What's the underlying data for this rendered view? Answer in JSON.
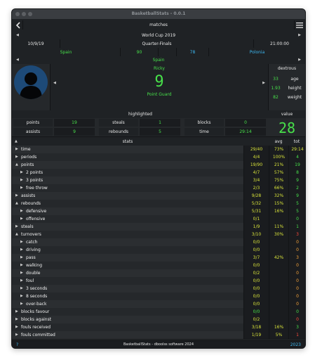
{
  "window": {
    "title": "BasketballStats - 0.0.1"
  },
  "nav": {
    "title": "matches"
  },
  "match": {
    "competition": "World Cup 2019",
    "date": "10/9/19",
    "phase": "Quarter-Finals",
    "clock": "21:00:00",
    "team_home": "Spain",
    "score_home": "90",
    "score_away": "78",
    "team_away": "Polonia"
  },
  "team_selected": "Spain",
  "player": {
    "name": "Ricky",
    "number": "9",
    "position": "Point Guard",
    "hand": "dextrous",
    "age_value": "33",
    "age_label": "age",
    "height_value": "1.93",
    "height_label": "height",
    "weight_value": "82",
    "weight_label": "weight"
  },
  "highlighted": {
    "header": "highlighted",
    "value_header": "value",
    "value": "28",
    "rows": [
      [
        {
          "label": "points",
          "value": "19"
        },
        {
          "label": "steals",
          "value": "1"
        },
        {
          "label": "blocks",
          "value": "0"
        }
      ],
      [
        {
          "label": "assists",
          "value": "9"
        },
        {
          "label": "rebounds",
          "value": "5"
        },
        {
          "label": "time",
          "value": "29:14"
        }
      ]
    ]
  },
  "stats_header": {
    "label": "stats",
    "avg": "avg",
    "tot": "tot"
  },
  "stats": [
    {
      "label": "time",
      "level": 0,
      "open": false,
      "v1": "29/40",
      "v1c": "y",
      "v2": "73%",
      "v2c": "y",
      "v3": "29:14",
      "v3c": "y"
    },
    {
      "label": "periods",
      "level": 0,
      "open": false,
      "v1": "4/4",
      "v1c": "y",
      "v2": "100%",
      "v2c": "y",
      "v3": "4",
      "v3c": "g"
    },
    {
      "label": "points",
      "level": 0,
      "open": true,
      "v1": "19/90",
      "v1c": "y",
      "v2": "21%",
      "v2c": "y",
      "v3": "19",
      "v3c": "g"
    },
    {
      "label": "2 points",
      "level": 1,
      "open": false,
      "v1": "4/7",
      "v1c": "y",
      "v2": "57%",
      "v2c": "y",
      "v3": "8",
      "v3c": "g"
    },
    {
      "label": "3 points",
      "level": 1,
      "open": false,
      "v1": "3/4",
      "v1c": "y",
      "v2": "75%",
      "v2c": "y",
      "v3": "9",
      "v3c": "g"
    },
    {
      "label": "free throw",
      "level": 1,
      "open": false,
      "v1": "2/3",
      "v1c": "y",
      "v2": "66%",
      "v2c": "y",
      "v3": "2",
      "v3c": "g"
    },
    {
      "label": "assists",
      "level": 0,
      "open": false,
      "v1": "9/28",
      "v1c": "y",
      "v2": "32%",
      "v2c": "y",
      "v3": "9",
      "v3c": "g"
    },
    {
      "label": "rebounds",
      "level": 0,
      "open": true,
      "v1": "5/32",
      "v1c": "y",
      "v2": "15%",
      "v2c": "y",
      "v3": "5",
      "v3c": "g"
    },
    {
      "label": "defensive",
      "level": 1,
      "open": false,
      "v1": "5/31",
      "v1c": "y",
      "v2": "16%",
      "v2c": "y",
      "v3": "5",
      "v3c": "g"
    },
    {
      "label": "offensive",
      "level": 1,
      "open": false,
      "v1": "0/1",
      "v1c": "y",
      "v2": "",
      "v2c": "y",
      "v3": "0",
      "v3c": "g"
    },
    {
      "label": "steals",
      "level": 0,
      "open": false,
      "v1": "1/9",
      "v1c": "y",
      "v2": "11%",
      "v2c": "y",
      "v3": "1",
      "v3c": "g"
    },
    {
      "label": "turnovers",
      "level": 0,
      "open": true,
      "v1": "3/10",
      "v1c": "y",
      "v2": "30%",
      "v2c": "y",
      "v3": "3",
      "v3c": "r"
    },
    {
      "label": "catch",
      "level": 1,
      "open": false,
      "v1": "0/0",
      "v1c": "y",
      "v2": "",
      "v2c": "y",
      "v3": "0",
      "v3c": "o"
    },
    {
      "label": "driving",
      "level": 1,
      "open": false,
      "v1": "0/0",
      "v1c": "y",
      "v2": "",
      "v2c": "y",
      "v3": "0",
      "v3c": "o"
    },
    {
      "label": "pass",
      "level": 1,
      "open": false,
      "v1": "3/7",
      "v1c": "y",
      "v2": "42%",
      "v2c": "y",
      "v3": "3",
      "v3c": "o"
    },
    {
      "label": "walking",
      "level": 1,
      "open": false,
      "v1": "0/0",
      "v1c": "y",
      "v2": "",
      "v2c": "y",
      "v3": "0",
      "v3c": "o"
    },
    {
      "label": "double",
      "level": 1,
      "open": false,
      "v1": "0/2",
      "v1c": "y",
      "v2": "",
      "v2c": "y",
      "v3": "0",
      "v3c": "o"
    },
    {
      "label": "foul",
      "level": 1,
      "open": false,
      "v1": "0/0",
      "v1c": "y",
      "v2": "",
      "v2c": "y",
      "v3": "0",
      "v3c": "o"
    },
    {
      "label": "3 seconds",
      "level": 1,
      "open": false,
      "v1": "0/0",
      "v1c": "y",
      "v2": "",
      "v2c": "y",
      "v3": "0",
      "v3c": "o"
    },
    {
      "label": "8 seconds",
      "level": 1,
      "open": false,
      "v1": "0/0",
      "v1c": "y",
      "v2": "",
      "v2c": "y",
      "v3": "0",
      "v3c": "o"
    },
    {
      "label": "over-back",
      "level": 1,
      "open": false,
      "v1": "0/0",
      "v1c": "y",
      "v2": "",
      "v2c": "y",
      "v3": "0",
      "v3c": "o"
    },
    {
      "label": "blocks favour",
      "level": 0,
      "open": false,
      "v1": "0/0",
      "v1c": "g",
      "v2": "",
      "v2c": "y",
      "v3": "0",
      "v3c": "g"
    },
    {
      "label": "blocks against",
      "level": 0,
      "open": false,
      "v1": "0/2",
      "v1c": "y",
      "v2": "",
      "v2c": "y",
      "v3": "0",
      "v3c": "r"
    },
    {
      "label": "fouls received",
      "level": 0,
      "open": false,
      "v1": "3/18",
      "v1c": "y",
      "v2": "16%",
      "v2c": "y",
      "v3": "3",
      "v3c": "g"
    },
    {
      "label": "fouls committed",
      "level": 0,
      "open": false,
      "v1": "1/19",
      "v1c": "y",
      "v2": "5%",
      "v2c": "y",
      "v3": "1",
      "v3c": "r"
    }
  ],
  "footer": {
    "left": "?",
    "center": "BasketballStats - dboolss software 2024",
    "right": "2023"
  },
  "colors": {
    "green": "#47e04a",
    "blue": "#3cb6ef",
    "yellow": "#d7e23a",
    "orange": "#f4a33a",
    "red": "#ff4a3c",
    "background": "#25282b"
  },
  "icons": {
    "back": "chevron-left-icon",
    "menu": "hamburger-menu-icon",
    "avatar": "person-silhouette-icon"
  }
}
